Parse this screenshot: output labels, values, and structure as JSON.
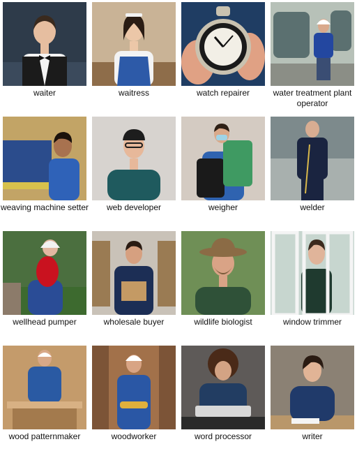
{
  "grid": {
    "items": [
      {
        "label": "waiter",
        "scene": "person",
        "bg": "#2e3b4a",
        "floor": "#3b4a5c",
        "skin": "#e6bea0",
        "hair": "#3a2a1e",
        "shirt": "#f4f4f4",
        "vest": "#1b1b1b",
        "accent": "#111111"
      },
      {
        "label": "waitress",
        "scene": "person",
        "bg": "#c9b396",
        "floor": "#8e6d4a",
        "skin": "#ecc7a8",
        "hair": "#2a1c14",
        "shirt": "#f3f3f3",
        "vest": "#2d5aa8",
        "accent": "#f2f2f2"
      },
      {
        "label": "watch repairer",
        "scene": "watch",
        "bg": "#1f3d63",
        "floor": "#2a4b74",
        "skin": "#e0a184",
        "hair": "#000000",
        "shirt": "#1f3d63",
        "vest": "#1f3d63",
        "accent": "#c9c2b0"
      },
      {
        "label": "water treatment plant operator",
        "scene": "person",
        "bg": "#b7c1b8",
        "floor": "#8b8e86",
        "skin": "#d9a98c",
        "hair": "#ffffff",
        "shirt": "#2347a0",
        "vest": "#2347a0",
        "accent": "#5b7070"
      },
      {
        "label": "weaving machine setter",
        "scene": "person",
        "bg": "#c2a466",
        "floor": "#2b4c8c",
        "skin": "#a8724f",
        "hair": "#1b120c",
        "shirt": "#2f62b8",
        "vest": "#2f62b8",
        "accent": "#d7c14c"
      },
      {
        "label": "web developer",
        "scene": "person",
        "bg": "#d7d3cf",
        "floor": "#c6c1bc",
        "skin": "#e7b89a",
        "hair": "#2a1f18",
        "shirt": "#1f5a5e",
        "vest": "#1f5a5e",
        "accent": "#1d1d1d"
      },
      {
        "label": "weigher",
        "scene": "person",
        "bg": "#d4cbc2",
        "floor": "#b8aa9a",
        "skin": "#d9a98a",
        "hair": "#2e2016",
        "shirt": "#2f63b0",
        "vest": "#1a1a1a",
        "accent": "#3f9a62"
      },
      {
        "label": "welder",
        "scene": "person",
        "bg": "#7d8a8c",
        "floor": "#a8b0ae",
        "skin": "#d8ad92",
        "hair": "#3a2b20",
        "shirt": "#1a2440",
        "vest": "#1a2440",
        "accent": "#d8b84b"
      },
      {
        "label": "wellhead pumper",
        "scene": "pumper",
        "bg": "#4b6f3f",
        "floor": "#3d6a2f",
        "skin": "#e2b7a1",
        "hair": "#ffffff",
        "shirt": "#2a4c96",
        "vest": "#c9121f",
        "accent": "#f2f2f2"
      },
      {
        "label": "wholesale buyer",
        "scene": "person",
        "bg": "#c9c2b8",
        "floor": "#d6d0c8",
        "skin": "#d6a080",
        "hair": "#2a1b12",
        "shirt": "#1c2e55",
        "vest": "#1c2e55",
        "accent": "#c49a64"
      },
      {
        "label": "wildlife biologist",
        "scene": "person",
        "bg": "#6f8f56",
        "floor": "#5e7b46",
        "skin": "#d9a386",
        "hair": "#7a5b3a",
        "shirt": "#2f5138",
        "vest": "#2f5138",
        "accent": "#8b6b45"
      },
      {
        "label": "window trimmer",
        "scene": "window",
        "bg": "#c7d6cf",
        "floor": "#b7c8bf",
        "skin": "#e0b49a",
        "hair": "#3c2a1e",
        "shirt": "#1f3a2f",
        "vest": "#1f3a2f",
        "accent": "#f4f4f4"
      },
      {
        "label": "wood patternmaker",
        "scene": "person",
        "bg": "#c49b6b",
        "floor": "#a37a4d",
        "skin": "#d8a888",
        "hair": "#ffffff",
        "shirt": "#2a5aa3",
        "vest": "#2a5aa3",
        "accent": "#d8b184"
      },
      {
        "label": "woodworker",
        "scene": "person",
        "bg": "#a2714a",
        "floor": "#7c5437",
        "skin": "#d8a484",
        "hair": "#ffffff",
        "shirt": "#2a57a5",
        "vest": "#2a57a5",
        "accent": "#e0b03c"
      },
      {
        "label": "word processor",
        "scene": "person",
        "bg": "#5e5a58",
        "floor": "#2a2a2a",
        "skin": "#d3a384",
        "hair": "#4a2a18",
        "shirt": "#223d62",
        "vest": "#223d62",
        "accent": "#d8d8d8"
      },
      {
        "label": "writer",
        "scene": "person",
        "bg": "#8b8174",
        "floor": "#b9976a",
        "skin": "#e1b496",
        "hair": "#2a1b12",
        "shirt": "#203a6a",
        "vest": "#203a6a",
        "accent": "#f4f4f4"
      }
    ]
  }
}
